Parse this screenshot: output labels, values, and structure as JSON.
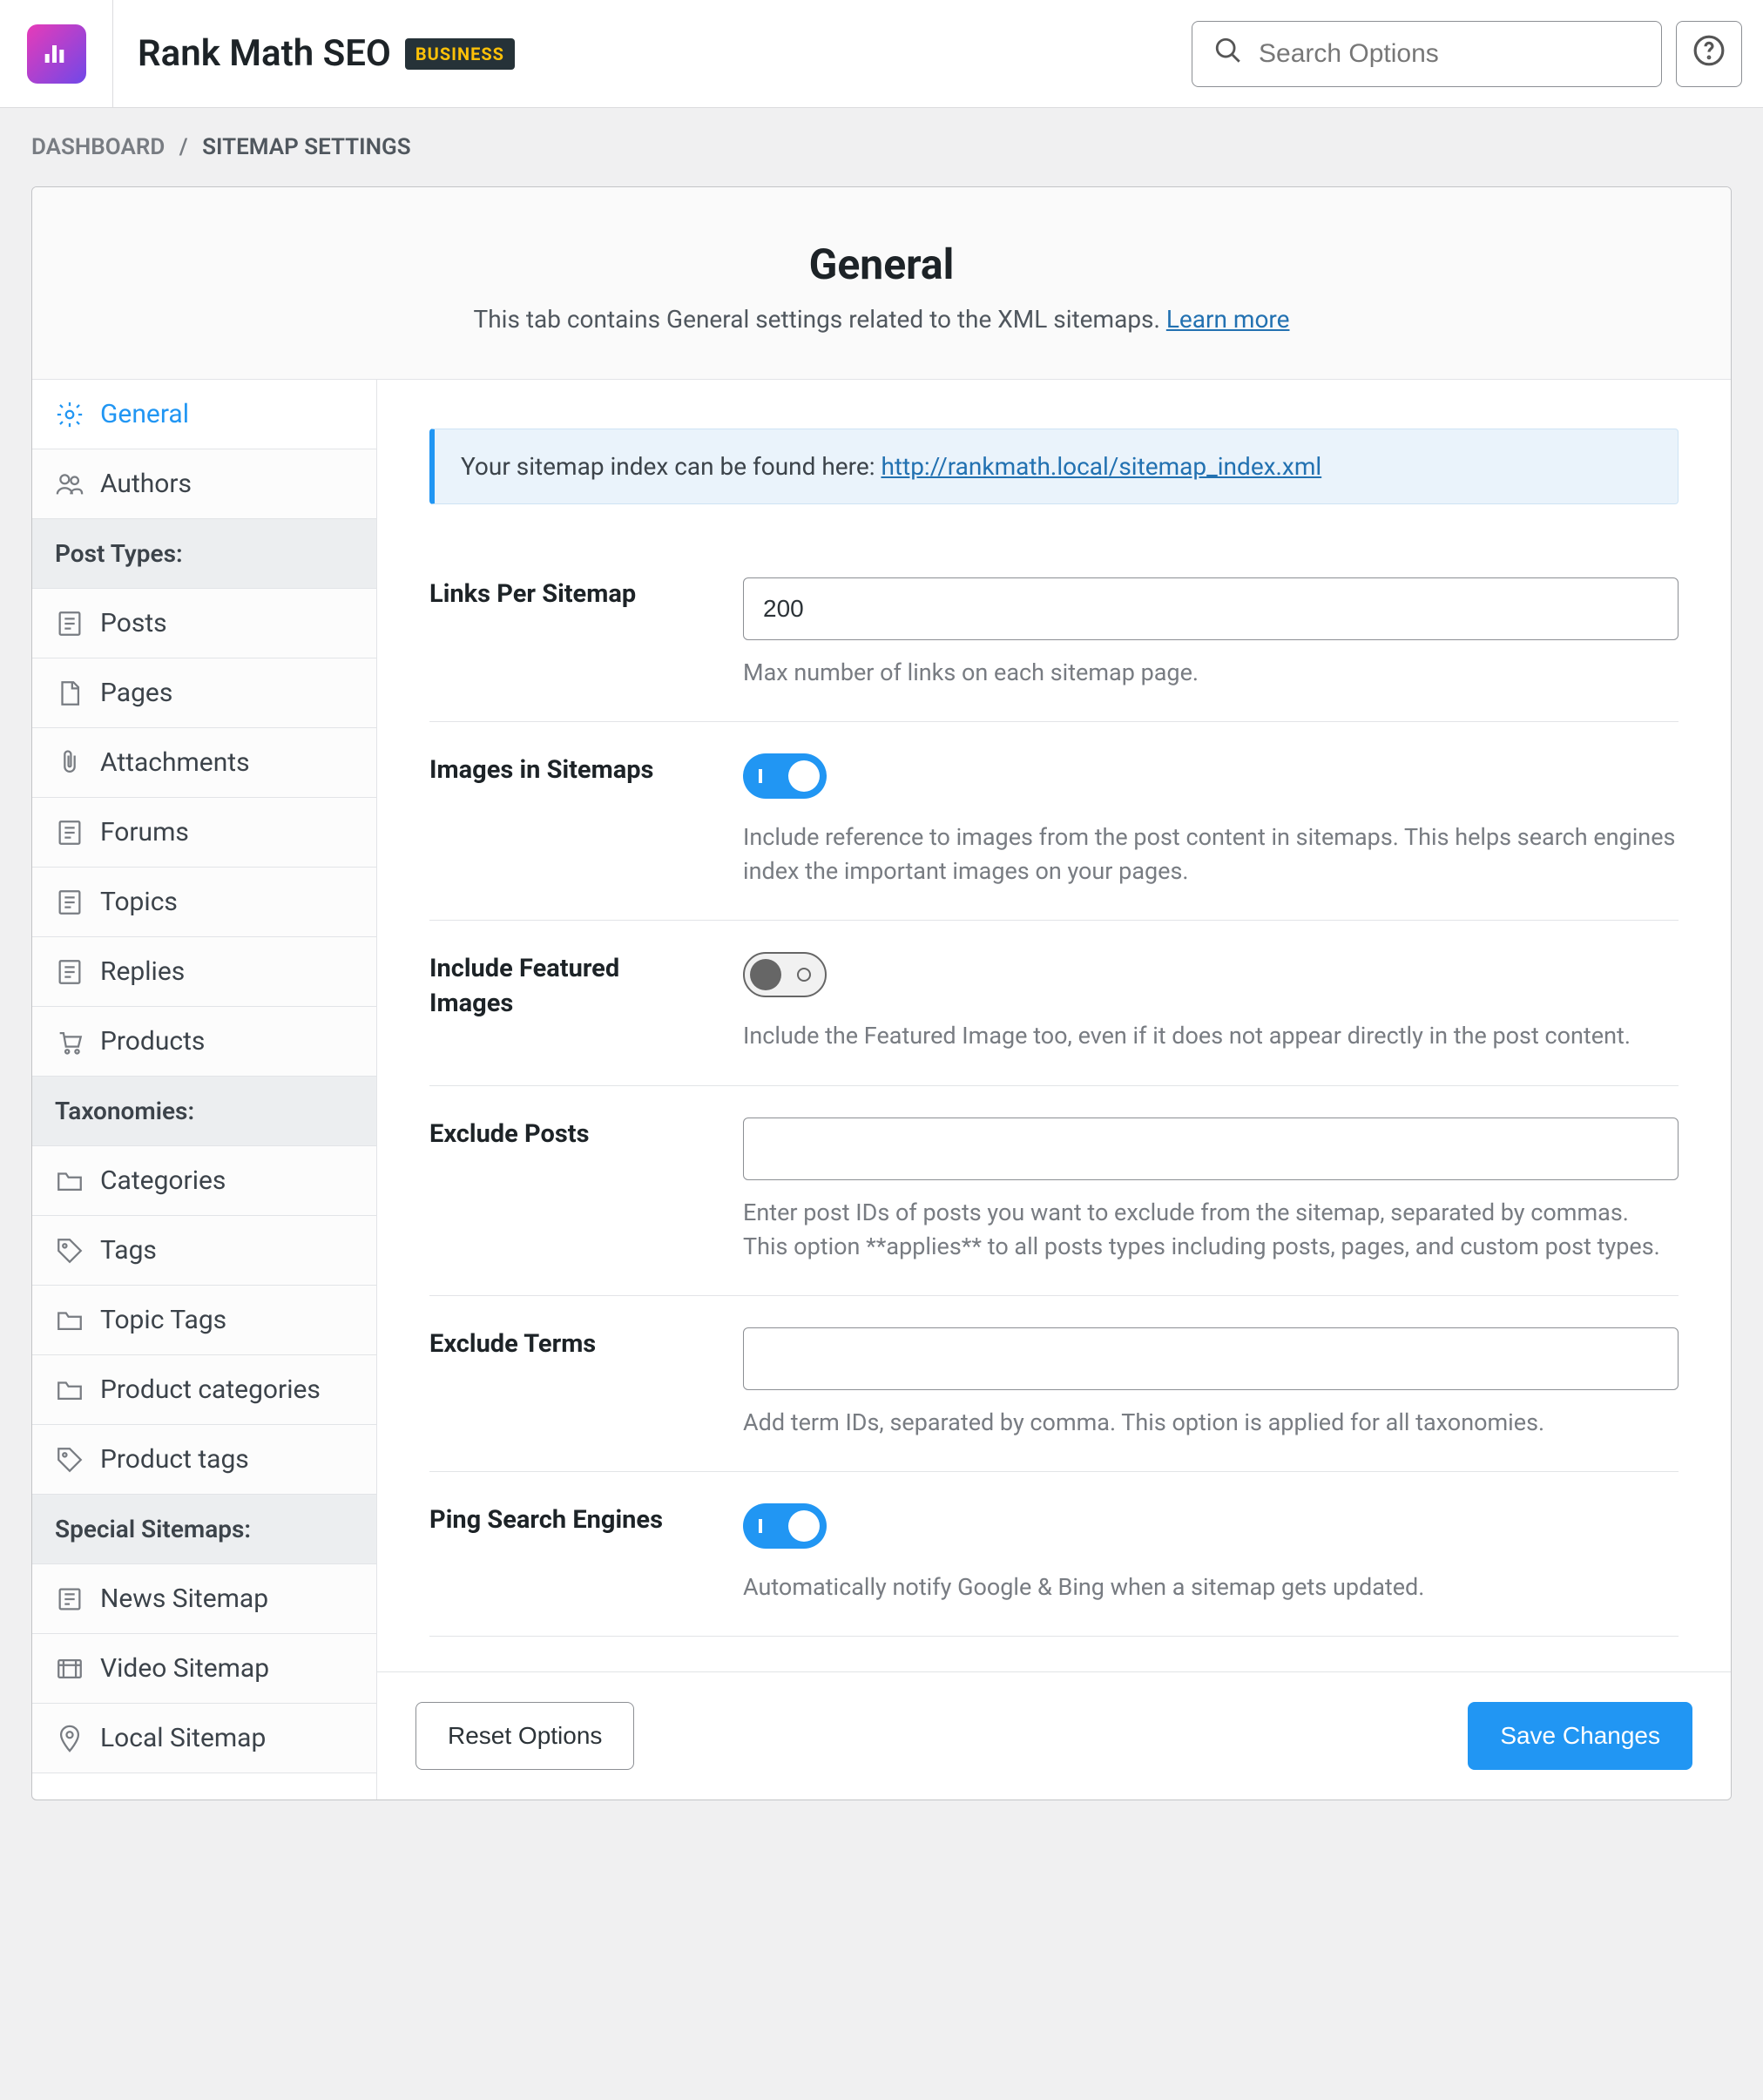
{
  "header": {
    "app_title": "Rank Math SEO",
    "badge": "BUSINESS",
    "search_placeholder": "Search Options"
  },
  "breadcrumb": {
    "root": "DASHBOARD",
    "current": "SITEMAP SETTINGS"
  },
  "panel": {
    "title": "General",
    "subtitle_text": "This tab contains General settings related to the XML sitemaps.",
    "subtitle_link": "Learn more"
  },
  "sidebar": {
    "items_top": [
      {
        "label": "General",
        "icon": "gear"
      },
      {
        "label": "Authors",
        "icon": "users"
      }
    ],
    "group_post_types": "Post Types:",
    "items_post_types": [
      {
        "label": "Posts",
        "icon": "post"
      },
      {
        "label": "Pages",
        "icon": "page"
      },
      {
        "label": "Attachments",
        "icon": "clip"
      },
      {
        "label": "Forums",
        "icon": "post"
      },
      {
        "label": "Topics",
        "icon": "post"
      },
      {
        "label": "Replies",
        "icon": "post"
      },
      {
        "label": "Products",
        "icon": "cart"
      }
    ],
    "group_taxonomies": "Taxonomies:",
    "items_taxonomies": [
      {
        "label": "Categories",
        "icon": "folder"
      },
      {
        "label": "Tags",
        "icon": "tag"
      },
      {
        "label": "Topic Tags",
        "icon": "folder"
      },
      {
        "label": "Product categories",
        "icon": "folder"
      },
      {
        "label": "Product tags",
        "icon": "tag"
      }
    ],
    "group_special": "Special Sitemaps:",
    "items_special": [
      {
        "label": "News Sitemap",
        "icon": "news"
      },
      {
        "label": "Video Sitemap",
        "icon": "video"
      },
      {
        "label": "Local Sitemap",
        "icon": "pin"
      }
    ]
  },
  "notice": {
    "prefix": "Your sitemap index can be found here: ",
    "url": "http://rankmath.local/sitemap_index.xml"
  },
  "fields": {
    "links_per_sitemap": {
      "label": "Links Per Sitemap",
      "value": "200",
      "desc": "Max number of links on each sitemap page."
    },
    "images_in_sitemaps": {
      "label": "Images in Sitemaps",
      "on": true,
      "desc": "Include reference to images from the post content in sitemaps. This helps search engines index the important images on your pages."
    },
    "include_featured": {
      "label": "Include Featured Images",
      "on": false,
      "desc": "Include the Featured Image too, even if it does not appear directly in the post content."
    },
    "exclude_posts": {
      "label": "Exclude Posts",
      "value": "",
      "desc": "Enter post IDs of posts you want to exclude from the sitemap, separated by commas. This option **applies** to all posts types including posts, pages, and custom post types."
    },
    "exclude_terms": {
      "label": "Exclude Terms",
      "value": "",
      "desc": "Add term IDs, separated by comma. This option is applied for all taxonomies."
    },
    "ping": {
      "label": "Ping Search Engines",
      "on": true,
      "desc": "Automatically notify Google & Bing when a sitemap gets updated."
    }
  },
  "footer": {
    "reset": "Reset Options",
    "save": "Save Changes"
  }
}
